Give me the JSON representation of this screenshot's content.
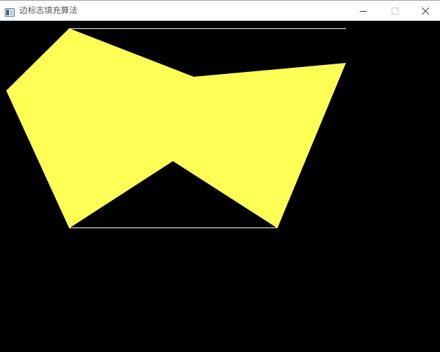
{
  "window": {
    "title": "边标志填充算法",
    "controls": [
      "minimize",
      "maximize",
      "close"
    ]
  },
  "canvas": {
    "background": "#000000",
    "fill_color": "#ffff55",
    "edge_color": "#ffffff"
  },
  "icons": {
    "app": "app-window-icon",
    "minimize": "minimize-icon",
    "maximize": "maximize-icon",
    "close": "close-icon"
  }
}
